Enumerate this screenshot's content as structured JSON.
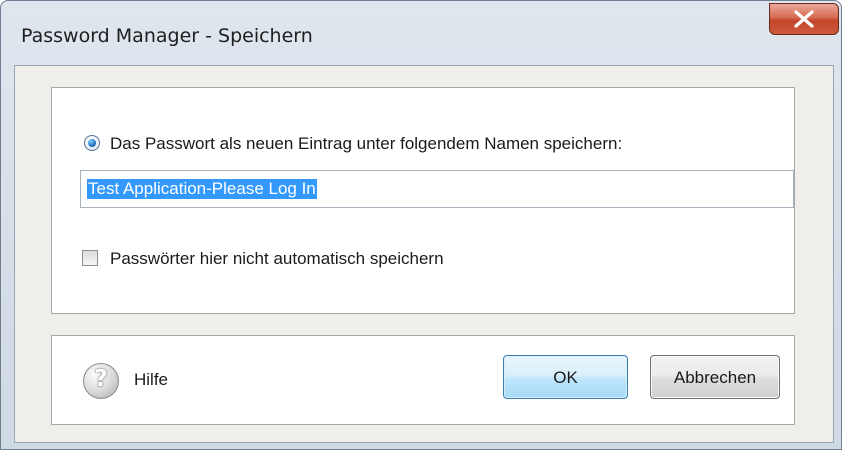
{
  "window": {
    "title": "Password Manager - Speichern",
    "close_icon": "close-icon"
  },
  "save_option": {
    "label": "Das Passwort als neuen Eintrag unter folgendem Namen speichern:",
    "selected": true
  },
  "entry_name": {
    "value": "Test Application-Please Log In"
  },
  "auto_save_option": {
    "label": "Passwörter hier nicht automatisch speichern",
    "checked": false
  },
  "footer": {
    "help_icon": "help-icon",
    "help_glyph": "?",
    "help_label": "Hilfe",
    "ok_label": "OK",
    "cancel_label": "Abbrechen"
  },
  "colors": {
    "selection": "#3399ff",
    "close_button": "#c3452b",
    "ok_button": "#bee6fd"
  }
}
